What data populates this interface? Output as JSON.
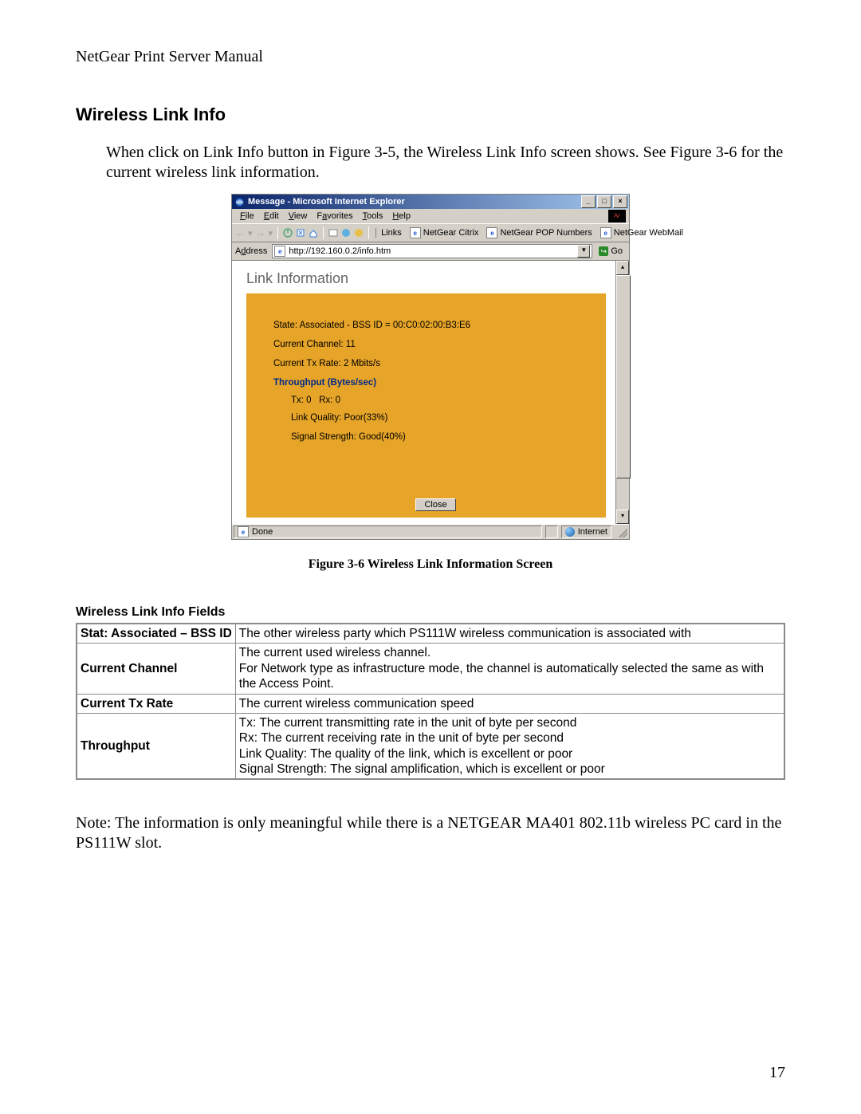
{
  "doc": {
    "header": "NetGear Print Server Manual",
    "section_title": "Wireless Link Info",
    "intro": "When click on Link Info button in Figure 3-5, the Wireless Link Info screen shows. See Figure 3-6 for the current wireless link information.",
    "figure_caption": "Figure 3-6 Wireless Link Information Screen",
    "fields_heading": "Wireless Link Info Fields",
    "note": "Note: The information is only meaningful while there is a NETGEAR MA401 802.11b wireless PC card in the PS111W slot.",
    "page_number": "17"
  },
  "ie": {
    "title": "Message - Microsoft Internet Explorer",
    "menus": {
      "file": "File",
      "edit": "Edit",
      "view": "View",
      "favorites": "Favorites",
      "tools": "Tools",
      "help": "Help"
    },
    "links_label": "Links",
    "fav_links": {
      "a": "NetGear Citrix",
      "b": "NetGear POP Numbers",
      "c": "NetGear WebMail"
    },
    "address_label": "Address",
    "url": "http://192.160.0.2/info.htm",
    "go_label": "Go",
    "page_heading": "Link Information",
    "lines": {
      "state": "State: Associated - BSS ID = 00:C0:02:00:B3:E6",
      "channel": "Current Channel: 11",
      "txrate": "Current Tx Rate: 2 Mbits/s",
      "throughput_heading": "Throughput (Bytes/sec)",
      "tx": "Tx: 0",
      "rx": "Rx: 0",
      "link_quality": "Link Quality: Poor(33%)",
      "signal_strength": "Signal Strength: Good(40%)"
    },
    "close_label": "Close",
    "status_done": "Done",
    "status_zone": "Internet"
  },
  "fields_table": {
    "r1": {
      "label": "Stat: Associated – BSS ID",
      "desc": "The other wireless party which PS111W wireless communication is associated with"
    },
    "r2": {
      "label": "Current Channel",
      "desc": "The current used wireless channel.\nFor Network type as infrastructure mode, the channel is automatically selected the same as with the Access Point."
    },
    "r3": {
      "label": "Current Tx Rate",
      "desc": "The current wireless communication speed"
    },
    "r4": {
      "label": "Throughput",
      "desc": "Tx: The current transmitting rate in the unit of byte per second\nRx: The current receiving rate in the unit of byte per second\nLink Quality: The quality of the link, which is excellent or poor\nSignal Strength: The signal amplification, which is excellent or poor"
    }
  }
}
